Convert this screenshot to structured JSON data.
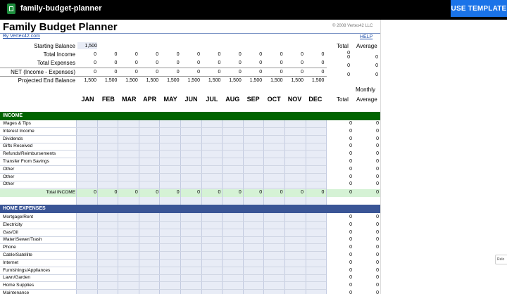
{
  "topbar": {
    "filename": "family-budget-planner",
    "use_template": "USE TEMPLATE"
  },
  "sheet": {
    "title": "Family Budget Planner",
    "copyright": "© 2008 Vertex42 LLC",
    "byline": "By Vertex42.com",
    "help": "HELP",
    "summary_labels": [
      "Starting Balance",
      "Total Income",
      "Total Expenses",
      "NET (Income - Expenses)",
      "Projected End Balance"
    ],
    "starting_balance": "1,500",
    "summary_total_header": "Total",
    "summary_average_header": "Average",
    "zero": "0",
    "projected": "1,500",
    "months": [
      "JAN",
      "FEB",
      "MAR",
      "APR",
      "MAY",
      "JUN",
      "JUL",
      "AUG",
      "SEP",
      "OCT",
      "NOV",
      "DEC"
    ],
    "monthly_label": "Monthly",
    "col_total": "Total",
    "col_average": "Average",
    "income_header": "INCOME",
    "income_items": [
      "Wages & Tips",
      "Interest Income",
      "Dividends",
      "Gifts Received",
      "Refunds/Reimbursements",
      "Transfer From Savings",
      "Other",
      "Other",
      "Other"
    ],
    "total_income_label": "Total INCOME",
    "home_header": "HOME EXPENSES",
    "home_items": [
      "Mortgage/Rent",
      "Electricity",
      "Gas/Oil",
      "Water/Sewer/Trash",
      "Phone",
      "Cable/Satellite",
      "Internet",
      "Furnishings/Appliances",
      "Lawn/Garden",
      "Home Supplies",
      "Maintenance"
    ]
  },
  "side_button": {
    "label": "Relo"
  },
  "colors": {
    "income_header": "#006400",
    "home_header": "#3a5596",
    "grid_fill": "#e8ecf6",
    "total_row": "#d5f2d5",
    "use_template_bg": "#1a73e8"
  }
}
